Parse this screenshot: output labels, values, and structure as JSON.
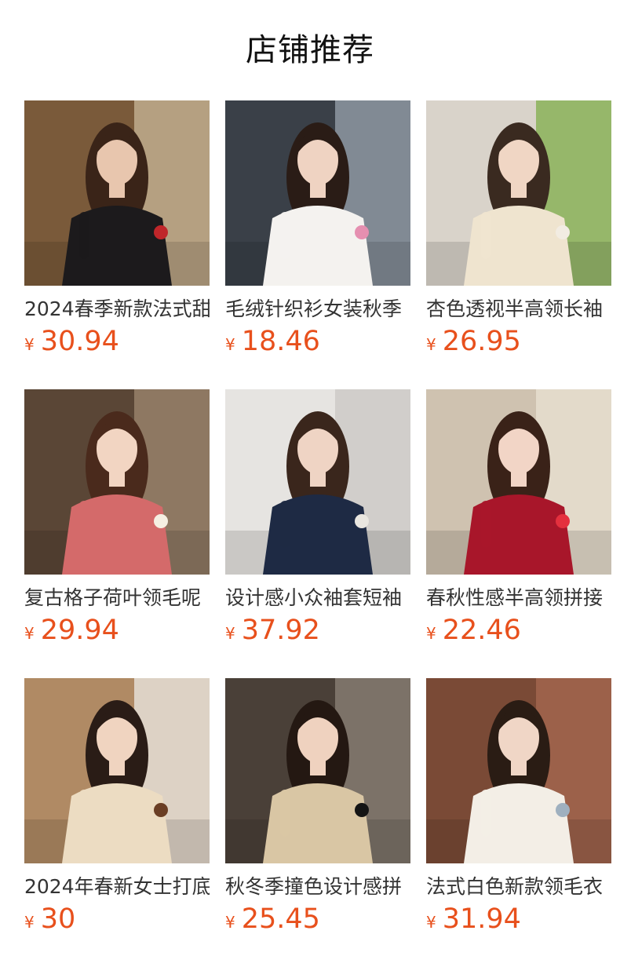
{
  "header": {
    "title": "店铺推荐"
  },
  "theme": {
    "price_color": "#e8501c",
    "title_color": "#111111"
  },
  "products": [
    {
      "name": "2024春季新款法式甜",
      "currency": "¥",
      "price": "30.94",
      "image": "woman-black-sweater-red-beret-photo",
      "palette": {
        "bg": "#7a5a3a",
        "wall": "#c9b89a",
        "top": "#1c1a1c",
        "hair": "#3a2418",
        "accent": "#c0262a",
        "skin": "#e8c6ae"
      }
    },
    {
      "name": "毛绒针织衫女装秋季",
      "currency": "¥",
      "price": "18.46",
      "image": "woman-white-crop-top-phone-photo",
      "palette": {
        "bg": "#3a4048",
        "wall": "#9aa3ad",
        "top": "#f4f2ef",
        "hair": "#2a1c16",
        "accent": "#e58fb0",
        "skin": "#efd3c2"
      }
    },
    {
      "name": "杏色透视半高领长袖",
      "currency": "¥",
      "price": "26.95",
      "image": "woman-cream-knit-bear-hat-photo",
      "palette": {
        "bg": "#d9d3ca",
        "wall": "#7fae4a",
        "top": "#efe4cf",
        "hair": "#3a2a20",
        "accent": "#f2ece2",
        "skin": "#f0d6c4"
      }
    },
    {
      "name": "复古格子荷叶领毛呢",
      "currency": "¥",
      "price": "29.94",
      "image": "woman-red-plaid-jacket-ruffle-collar-photo",
      "palette": {
        "bg": "#5a4636",
        "wall": "#a08a72",
        "top": "#d46a6a",
        "hair": "#4a2a1c",
        "accent": "#f5efe2",
        "skin": "#f2d5c2"
      }
    },
    {
      "name": "设计感小众袖套短袖",
      "currency": "¥",
      "price": "37.92",
      "image": "woman-navy-knit-sweater-beanie-photo",
      "palette": {
        "bg": "#e6e4e1",
        "wall": "#c9c7c3",
        "top": "#1e2a44",
        "hair": "#3a261c",
        "accent": "#e9e6e0",
        "skin": "#efd4c4"
      }
    },
    {
      "name": "春秋性感半高领拼接",
      "currency": "¥",
      "price": "22.46",
      "image": "woman-red-off-shoulder-fur-sweater-photo",
      "palette": {
        "bg": "#cfc2b0",
        "wall": "#e9e1d3",
        "top": "#a8162a",
        "hair": "#3a2218",
        "accent": "#e4303e",
        "skin": "#f2d5c6"
      }
    },
    {
      "name": "2024年春新女士打底",
      "currency": "¥",
      "price": "30",
      "image": "woman-cream-turtleneck-ribbed-photo",
      "palette": {
        "bg": "#b08a64",
        "wall": "#eceae6",
        "top": "#ecdcc2",
        "hair": "#2a1c16",
        "accent": "#6a3e24",
        "skin": "#f0d4c0"
      }
    },
    {
      "name": "秋冬季撞色设计感拼",
      "currency": "¥",
      "price": "25.45",
      "image": "woman-beige-tweed-cardigan-pleated-skirt-photo",
      "palette": {
        "bg": "#4a4038",
        "wall": "#8d8378",
        "top": "#d9c6a4",
        "hair": "#241812",
        "accent": "#141414",
        "skin": "#efd2bf"
      }
    },
    {
      "name": "法式白色新款领毛衣",
      "currency": "¥",
      "price": "31.94",
      "image": "woman-white-sweater-jeans-mirror-photo",
      "palette": {
        "bg": "#7a4a36",
        "wall": "#a86a52",
        "top": "#f3eee6",
        "hair": "#2a1c14",
        "accent": "#9fb0bf",
        "skin": "#f0d6c6"
      }
    }
  ]
}
